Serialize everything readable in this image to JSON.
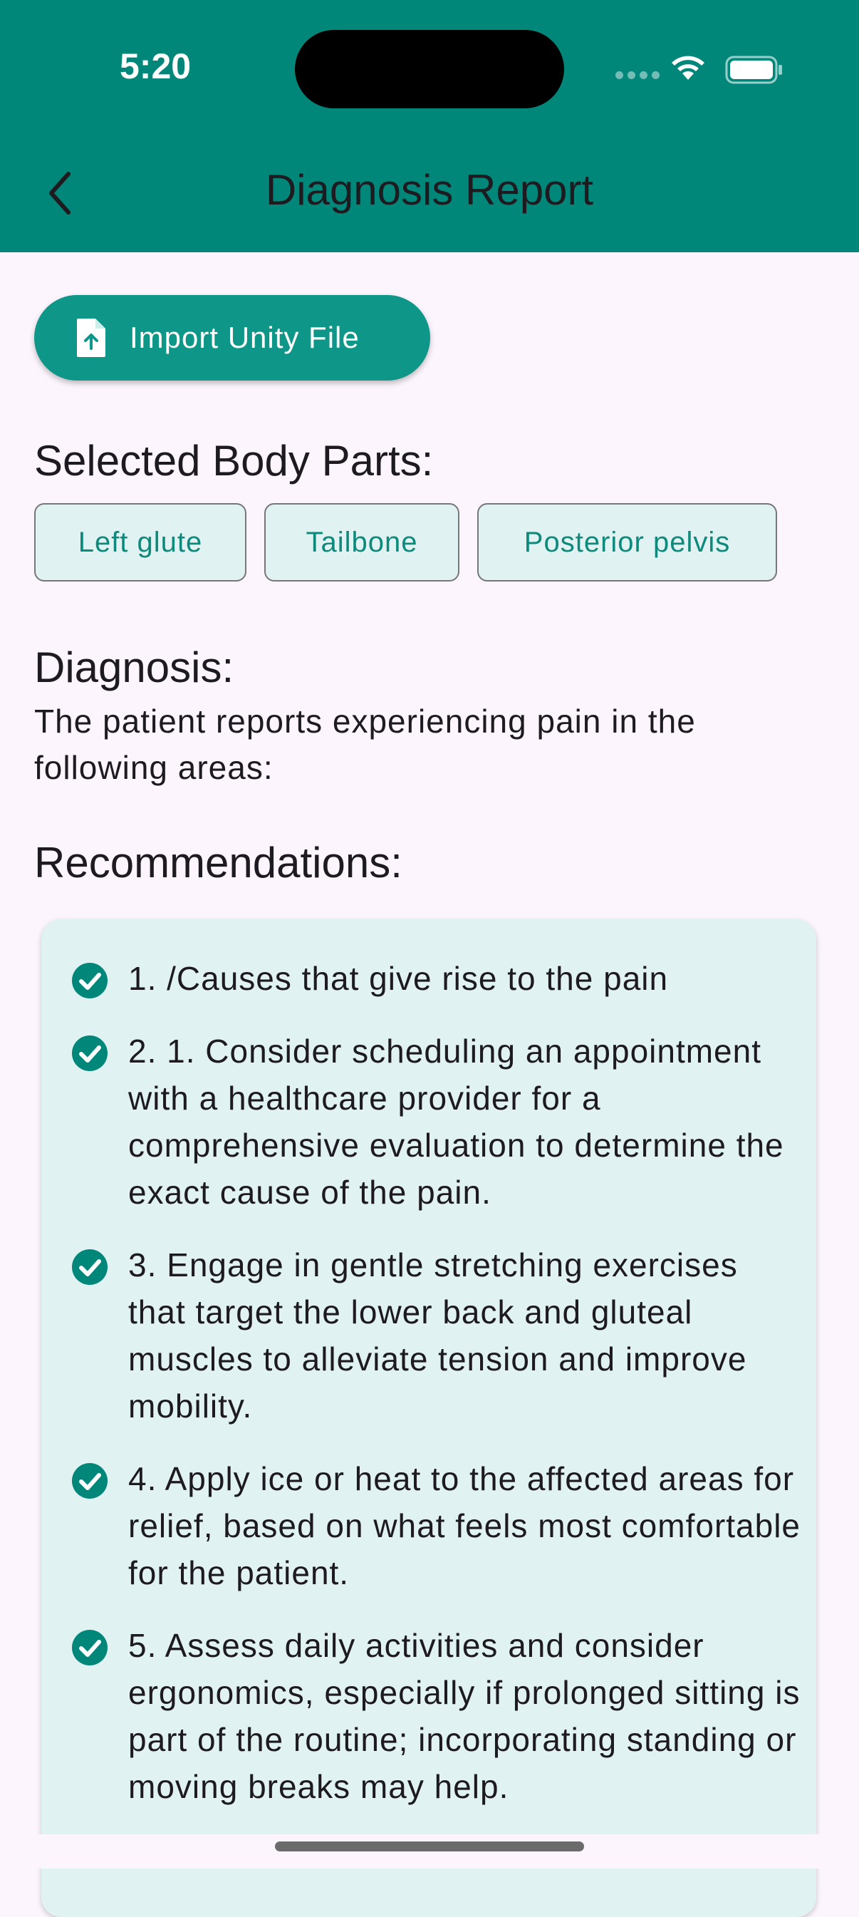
{
  "status": {
    "time": "5:20"
  },
  "header": {
    "title": "Diagnosis Report",
    "back_icon": "chevron-left-icon",
    "color": "#00877a"
  },
  "import_button": {
    "label": "Import Unity File",
    "icon": "file-upload-icon"
  },
  "selected_parts": {
    "heading": "Selected Body Parts:",
    "chips": [
      "Left glute",
      "Tailbone",
      "Posterior pelvis"
    ]
  },
  "diagnosis": {
    "heading": "Diagnosis:",
    "text": "The patient reports experiencing pain in the following areas:"
  },
  "recommendations": {
    "heading": "Recommendations:",
    "items": [
      "1. /Causes that give rise to the pain",
      "2. 1. Consider scheduling an appointment with a healthcare provider for a comprehensive evaluation to determine the exact cause of the pain.",
      "3. Engage in gentle stretching exercises that target the lower back and gluteal muscles to alleviate tension and improve mobility.",
      "4. Apply ice or heat to the affected areas for relief, based on what feels most comfortable for the patient.",
      "5. Assess daily activities and consider ergonomics, especially if prolonged sitting is part of the routine; incorporating standing or moving breaks may help."
    ]
  }
}
